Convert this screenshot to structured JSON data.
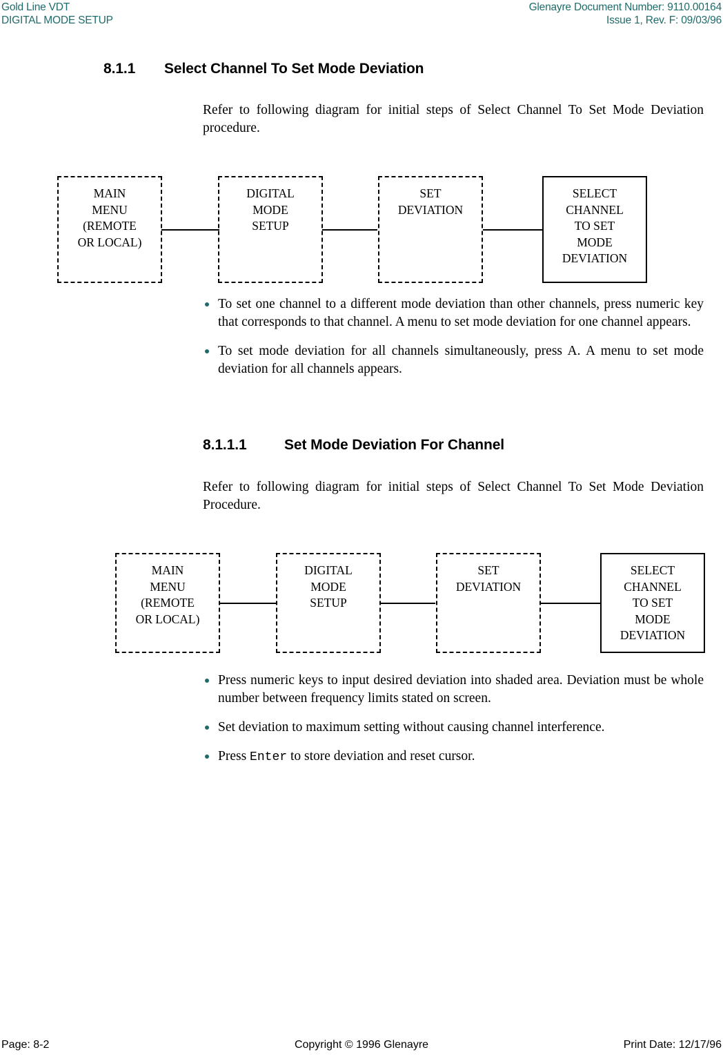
{
  "header": {
    "left_line1": "Gold Line VDT",
    "left_line2": "DIGITAL MODE SETUP",
    "right_line1": "Glenayre Document Number: 9110.00164",
    "right_line2": "Issue 1, Rev. F: 09/03/96",
    "color": "#1f6b6b"
  },
  "section1": {
    "number": "8.1.1",
    "title": "Select Channel To Set Mode Deviation",
    "paragraph": "Refer to following diagram for initial steps of Select Channel To Set Mode Deviation procedure.",
    "bullets": [
      "To set one channel to a different mode deviation than other channels, press numeric key that corresponds to that channel. A menu to set mode deviation for one channel appears.",
      "To set mode deviation for all channels simultaneously, press A. A menu to set mode deviation for all channels appears."
    ]
  },
  "section2": {
    "number": "8.1.1.1",
    "title": "Set Mode Deviation For Channel",
    "paragraph": "Refer to following diagram for initial steps of Select Channel To Set Mode Deviation Procedure.",
    "bullets": [
      {
        "prefix": "Press numeric keys to input desired deviation into shaded area. Deviation must be whole number between frequency limits stated on screen.",
        "mono": "",
        "suffix": ""
      },
      {
        "prefix": "Set deviation to maximum setting without causing channel interference.",
        "mono": "",
        "suffix": ""
      },
      {
        "prefix": "Press ",
        "mono": "Enter",
        "suffix": " to store deviation and reset cursor."
      }
    ]
  },
  "diagram1": {
    "boxes": [
      {
        "style": "dashed",
        "lines": [
          "MAIN",
          "MENU",
          "(REMOTE",
          "OR LOCAL)"
        ]
      },
      {
        "style": "dashed",
        "lines": [
          "DIGITAL",
          "MODE",
          "SETUP"
        ]
      },
      {
        "style": "dashed",
        "lines": [
          "SET",
          "DEVIATION"
        ]
      },
      {
        "style": "solid",
        "lines": [
          "SELECT",
          "CHANNEL",
          "TO SET",
          "MODE",
          "DEVIATION"
        ]
      }
    ]
  },
  "diagram2": {
    "boxes": [
      {
        "style": "dashed",
        "lines": [
          "MAIN",
          "MENU",
          "(REMOTE",
          "OR LOCAL)"
        ]
      },
      {
        "style": "dashed",
        "lines": [
          "DIGITAL",
          "MODE",
          "SETUP"
        ]
      },
      {
        "style": "dashed",
        "lines": [
          "SET",
          "DEVIATION"
        ]
      },
      {
        "style": "solid",
        "lines": [
          "SELECT",
          "CHANNEL",
          "TO SET",
          "MODE",
          "DEVIATION"
        ]
      }
    ]
  },
  "footer": {
    "left": "Page: 8-2",
    "center": "Copyright © 1996 Glenayre",
    "right": "Print Date: 12/17/96"
  }
}
